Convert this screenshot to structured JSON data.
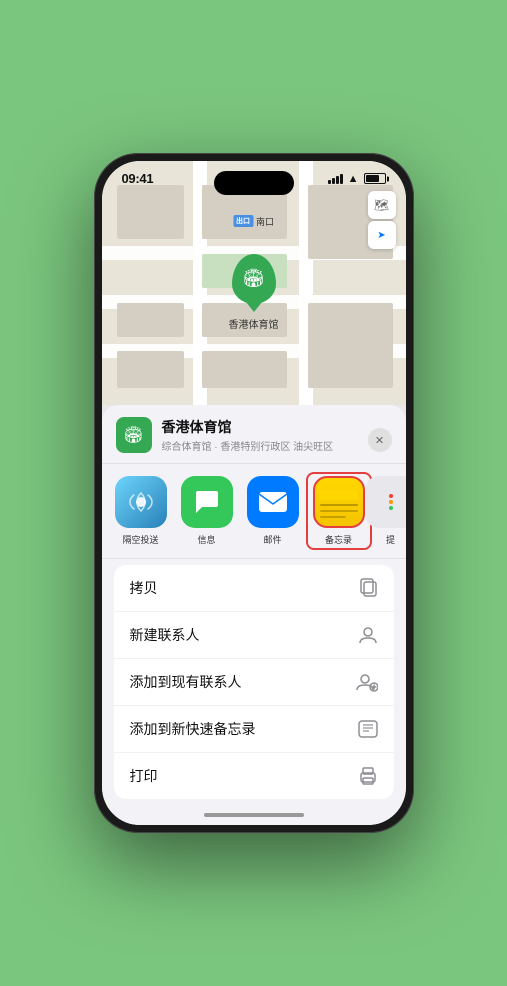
{
  "status_bar": {
    "time": "09:41",
    "location_arrow": "▲"
  },
  "map": {
    "label_badge": "出口",
    "label_text": "南口",
    "marker_label": "香港体育馆"
  },
  "map_controls": {
    "map_btn": "🗺",
    "location_btn": "➤"
  },
  "venue": {
    "name": "香港体育馆",
    "subtitle": "综合体育馆 · 香港特别行政区 油尖旺区",
    "close": "✕"
  },
  "share_items": [
    {
      "id": "airdrop",
      "label": "隔空投送",
      "icon_type": "airdrop"
    },
    {
      "id": "message",
      "label": "信息",
      "icon_type": "message"
    },
    {
      "id": "mail",
      "label": "邮件",
      "icon_type": "mail"
    },
    {
      "id": "notes",
      "label": "备忘录",
      "icon_type": "notes"
    },
    {
      "id": "more",
      "label": "提",
      "icon_type": "more"
    }
  ],
  "actions": [
    {
      "id": "copy",
      "text": "拷贝",
      "icon": "⎘"
    },
    {
      "id": "new-contact",
      "text": "新建联系人",
      "icon": "👤"
    },
    {
      "id": "add-existing",
      "text": "添加到现有联系人",
      "icon": "👤+"
    },
    {
      "id": "add-notes",
      "text": "添加到新快速备忘录",
      "icon": "📋"
    },
    {
      "id": "print",
      "text": "打印",
      "icon": "🖨"
    }
  ]
}
